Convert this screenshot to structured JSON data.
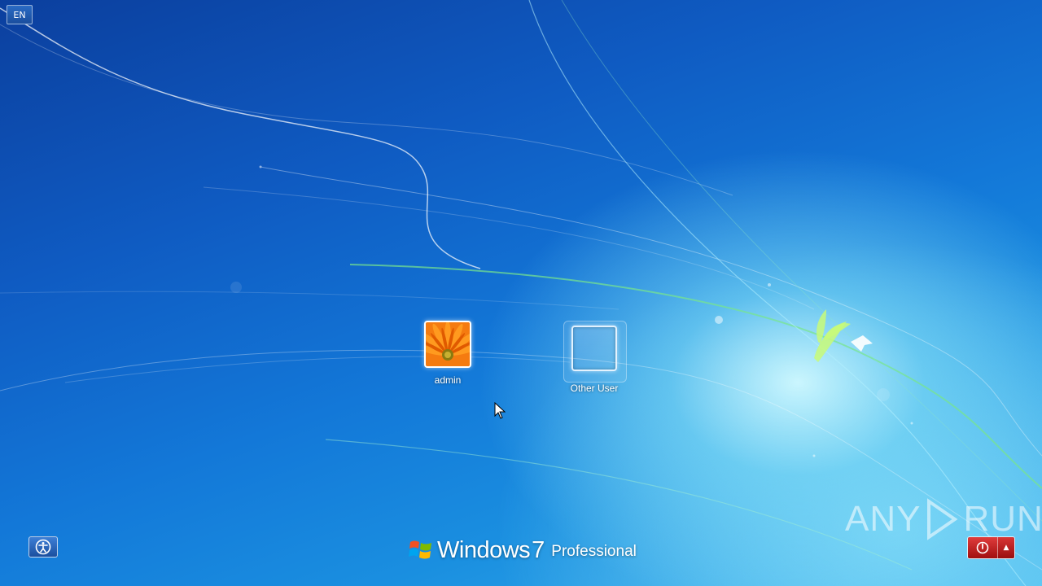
{
  "language": {
    "code": "EN"
  },
  "users": [
    {
      "name": "admin",
      "avatar": "flower-avatar-icon"
    },
    {
      "name": "Other User",
      "avatar": "blank-user-icon"
    }
  ],
  "branding": {
    "windows": "Windows",
    "version": "7",
    "edition": "Professional"
  },
  "watermark": {
    "left": "ANY",
    "right": "RUN"
  },
  "icons": {
    "ease_of_access": "ease-of-access-icon",
    "power": "power-icon",
    "options": "chevron-up-icon"
  },
  "colors": {
    "background": "#1378d8",
    "power": "#c01818"
  }
}
